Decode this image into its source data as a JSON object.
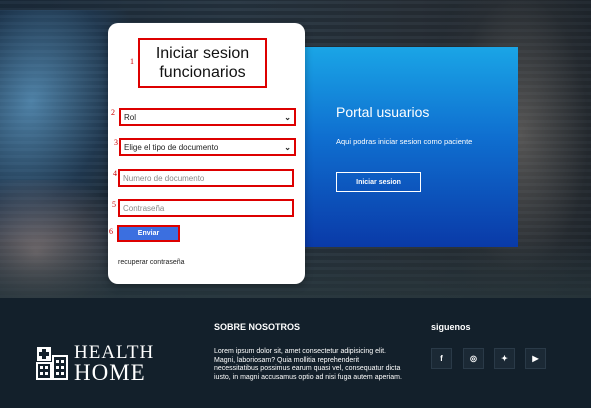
{
  "login": {
    "title": "Iniciar sesion funcionarios",
    "step_numbers": [
      "1",
      "2",
      "3",
      "4",
      "5",
      "6"
    ],
    "role_select": "Rol",
    "doc_type_select": "Elige el tipo de documento",
    "doc_number_placeholder": "Numero de documento",
    "password_placeholder": "Contraseña",
    "submit_label": "Enviar",
    "recover_link": "recuperar contraseña"
  },
  "portal": {
    "title": "Portal usuarios",
    "description": "Aqui podras iniciar sesion como paciente",
    "button_label": "Iniciar sesion"
  },
  "footer": {
    "logo_line1": "HEALTH",
    "logo_line2": "HOME",
    "about_title": "SOBRE NOSOTROS",
    "about_text": "Lorem ipsum dolor sit, amet consectetur adipisicing elit. Magni, laboriosam? Quia mollitia reprehenderit necessitatibus possimus earum quasi vel, consequatur dicta iusto, in magni accusamus optio ad nisi fuga autem aperiam.",
    "follow_title": "siguenos",
    "social": [
      {
        "icon": "facebook-icon",
        "glyph": "f"
      },
      {
        "icon": "instagram-icon",
        "glyph": "◎"
      },
      {
        "icon": "twitter-icon",
        "glyph": "✦"
      },
      {
        "icon": "youtube-icon",
        "glyph": "▶"
      }
    ]
  },
  "colors": {
    "highlight_border": "#dd0000",
    "submit_button": "#3b6fe0",
    "portal_gradient_top": "#1aa5e6",
    "portal_gradient_bottom": "#0a3aa8",
    "footer_bg": "#13202b"
  }
}
